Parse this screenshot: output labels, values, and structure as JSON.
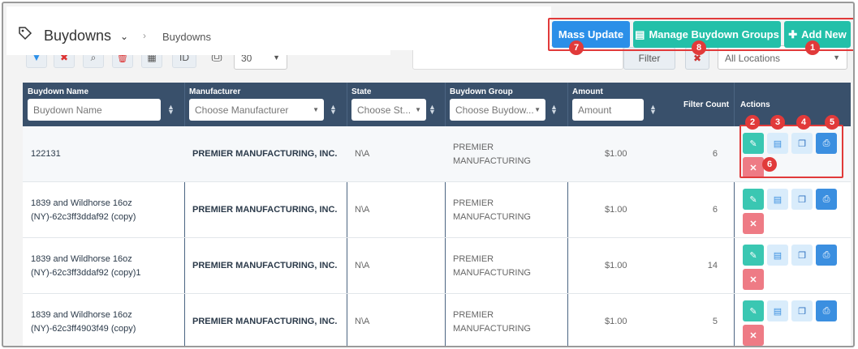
{
  "header": {
    "title": "Buydowns",
    "breadcrumb": "Buydowns",
    "buttons": {
      "mass_update": "Mass Update",
      "manage_groups": "Manage Buydown Groups",
      "add_new": "Add New"
    }
  },
  "toolbar": {
    "page_size": "30",
    "id_label": "ID",
    "filter_label": "Filter",
    "locations": "All Locations"
  },
  "table": {
    "columns": {
      "name": "Buydown Name",
      "manufacturer": "Manufacturer",
      "state": "State",
      "group": "Buydown Group",
      "amount": "Amount",
      "filter_count": "Filter Count",
      "actions": "Actions"
    },
    "filters": {
      "name_placeholder": "Buydown Name",
      "manufacturer_placeholder": "Choose Manufacturer",
      "state_placeholder": "Choose St...",
      "group_placeholder": "Choose Buydow...",
      "amount_placeholder": "Amount"
    },
    "rows": [
      {
        "name_line1": "122131",
        "name_line2": "",
        "manufacturer": "PREMIER MANUFACTURING, INC.",
        "state": "N\\A",
        "group_line1": "PREMIER",
        "group_line2": "MANUFACTURING",
        "amount": "$1.00",
        "filter_count": "6"
      },
      {
        "name_line1": "1839 and Wildhorse 16oz",
        "name_line2": "(NY)-62c3ff3ddaf92 (copy)",
        "manufacturer": "PREMIER MANUFACTURING, INC.",
        "state": "N\\A",
        "group_line1": "PREMIER",
        "group_line2": "MANUFACTURING",
        "amount": "$1.00",
        "filter_count": "6"
      },
      {
        "name_line1": "1839 and Wildhorse 16oz",
        "name_line2": "(NY)-62c3ff3ddaf92 (copy)1",
        "manufacturer": "PREMIER MANUFACTURING, INC.",
        "state": "N\\A",
        "group_line1": "PREMIER",
        "group_line2": "MANUFACTURING",
        "amount": "$1.00",
        "filter_count": "14"
      },
      {
        "name_line1": "1839 and Wildhorse 16oz",
        "name_line2": "(NY)-62c3ff4903f49 (copy)",
        "manufacturer": "PREMIER MANUFACTURING, INC.",
        "state": "N\\A",
        "group_line1": "PREMIER",
        "group_line2": "MANUFACTURING",
        "amount": "$1.00",
        "filter_count": "5"
      }
    ]
  },
  "badges": [
    "1",
    "2",
    "3",
    "4",
    "5",
    "6",
    "7",
    "8"
  ],
  "colors": {
    "header_bg": "#39506b",
    "accent_teal": "#23c0a9",
    "accent_blue": "#2b8fe8",
    "highlight_red": "#e13a3a",
    "delete_pink": "#ee7b85"
  }
}
